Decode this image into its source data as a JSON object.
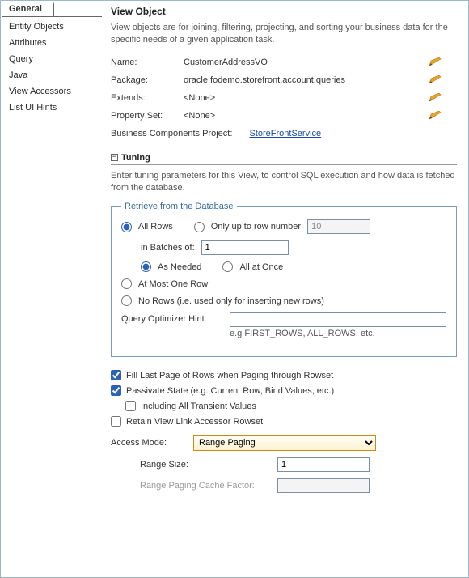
{
  "nav": {
    "active_tab": "General",
    "items": [
      "Entity Objects",
      "Attributes",
      "Query",
      "Java",
      "View Accessors",
      "List UI Hints"
    ]
  },
  "header": {
    "title": "View Object",
    "description": "View objects are for joining, filtering, projecting, and sorting your business data for the specific needs of a given application task."
  },
  "props": {
    "name": {
      "label": "Name:",
      "value": "CustomerAddressVO"
    },
    "package": {
      "label": "Package:",
      "value": "oracle.fodemo.storefront.account.queries"
    },
    "extends": {
      "label": "Extends:",
      "value": "<None>"
    },
    "propertySet": {
      "label": "Property Set:",
      "value": "<None>"
    }
  },
  "bcp": {
    "label": "Business Components Project:",
    "link": "StoreFrontService"
  },
  "tuning": {
    "title": "Tuning",
    "description": "Enter tuning parameters for this View, to control SQL execution and how data is fetched from the database.",
    "retrieve_legend": "Retrieve from the Database",
    "all_rows_label": "All Rows",
    "only_up_to_label": "Only up to row number",
    "only_up_to_value": "10",
    "in_batches_label": "in Batches of:",
    "in_batches_value": "1",
    "as_needed_label": "As Needed",
    "all_at_once_label": "All at Once",
    "at_most_one_label": "At Most One Row",
    "no_rows_label": "No Rows (i.e. used only for inserting new rows)",
    "optimizer_hint_label": "Query Optimizer Hint:",
    "optimizer_hint_value": "",
    "optimizer_hint_example": "e.g FIRST_ROWS, ALL_ROWS, etc.",
    "fill_last_page_label": "Fill Last Page of Rows when Paging through Rowset",
    "passivate_state_label": "Passivate State (e.g. Current Row, Bind Values, etc.)",
    "including_transient_label": "Including All Transient Values",
    "retain_vla_label": "Retain View Link Accessor Rowset",
    "access_mode_label": "Access Mode:",
    "access_mode_value": "Range Paging",
    "range_size_label": "Range Size:",
    "range_size_value": "1",
    "range_cache_label": "Range Paging Cache Factor:",
    "range_cache_value": ""
  }
}
